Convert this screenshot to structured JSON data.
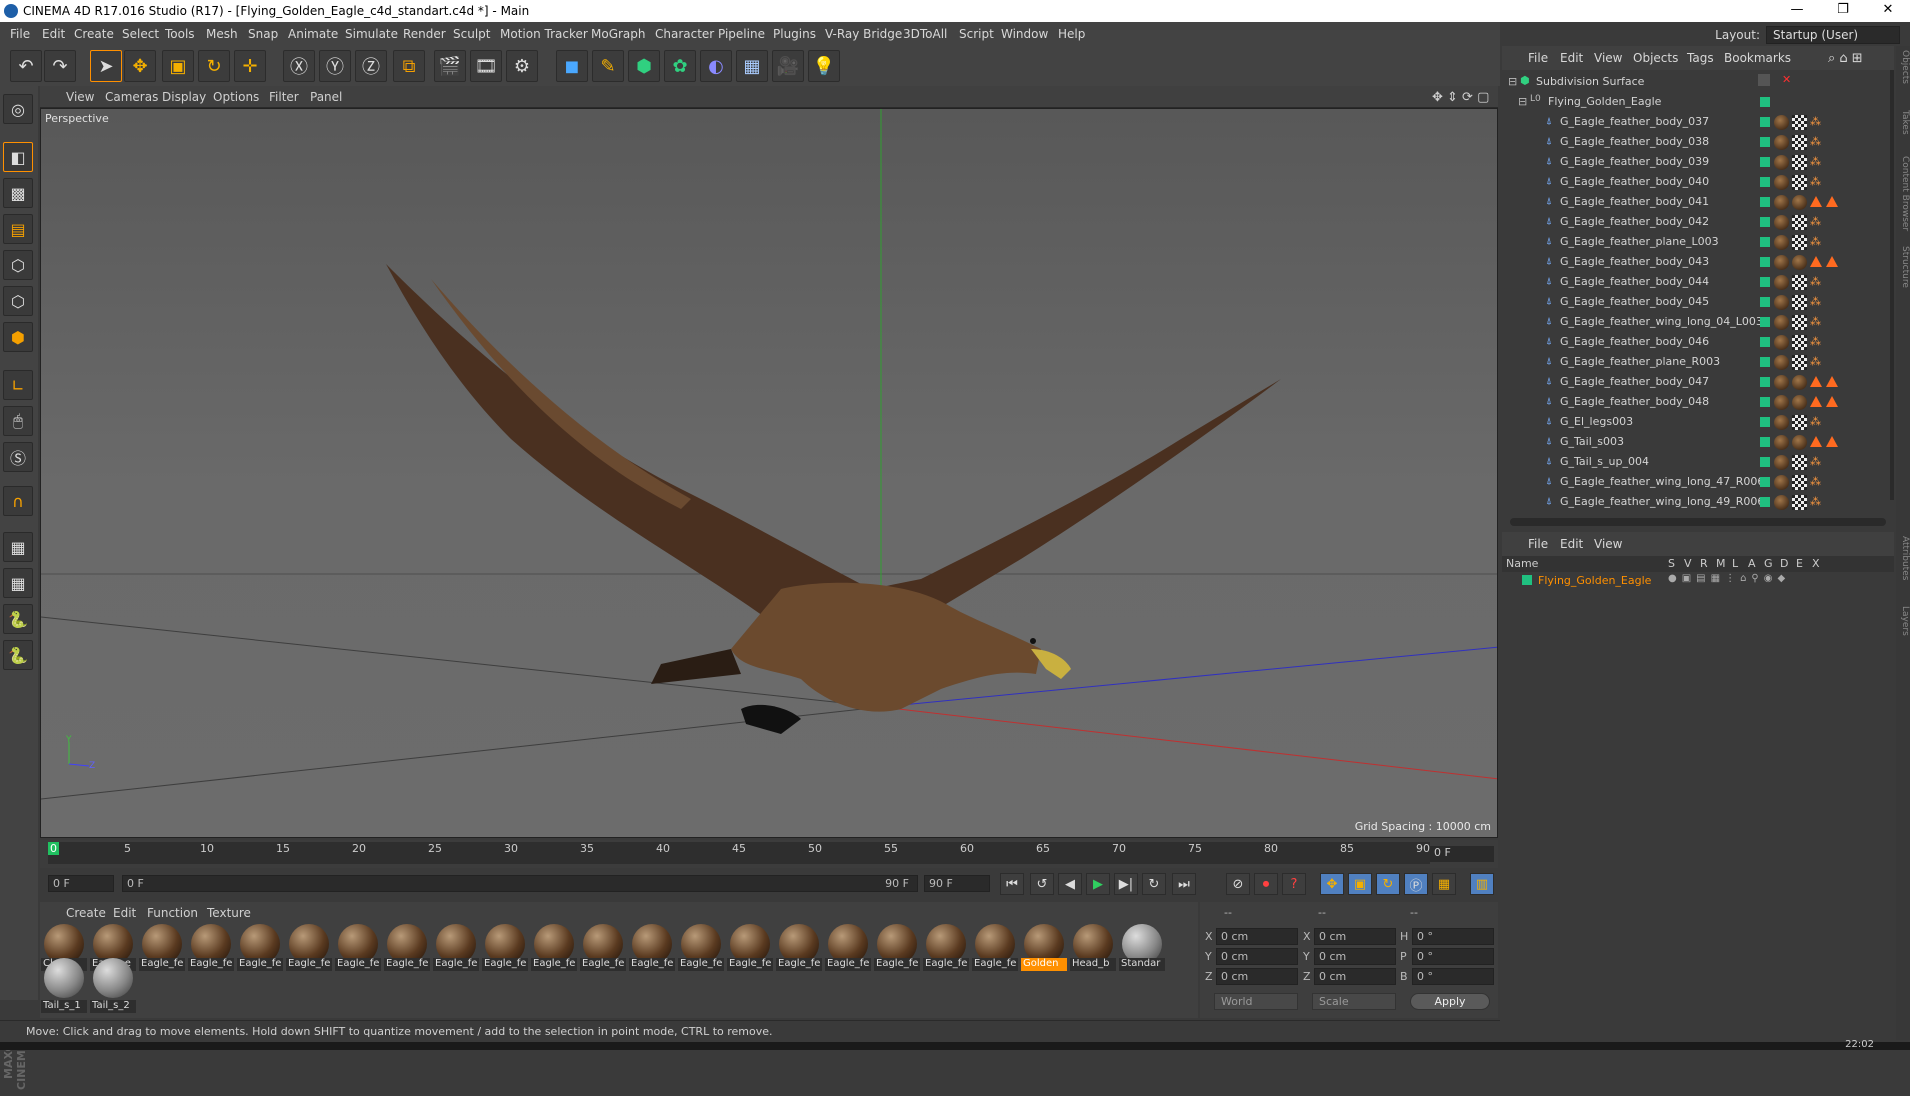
{
  "window": {
    "title": "CINEMA 4D R17.016 Studio (R17) - [Flying_Golden_Eagle_c4d_standart.c4d *] - Main",
    "controls": [
      "—",
      "❐",
      "✕"
    ]
  },
  "menubar": [
    "File",
    "Edit",
    "Create",
    "Select",
    "Tools",
    "Mesh",
    "Snap",
    "Animate",
    "Simulate",
    "Render",
    "Sculpt",
    "Motion Tracker",
    "MoGraph",
    "Character",
    "Pipeline",
    "Plugins",
    "V-Ray Bridge",
    "3DToAll",
    "Script",
    "Window",
    "Help"
  ],
  "layout": {
    "label": "Layout:",
    "value": "Startup (User)"
  },
  "toolbar_icons": [
    "undo-icon",
    "redo-icon",
    "select-pointer-icon",
    "move-icon",
    "scale-icon",
    "rotate-icon",
    "live-select-icon",
    "x-axis-icon",
    "y-axis-icon",
    "z-axis-icon",
    "coordinate-system-icon",
    "render-view-icon",
    "render-picture-viewer-icon",
    "render-settings-icon",
    "cube-icon",
    "pen-spline-icon",
    "subdivision-icon",
    "array-icon",
    "deformer-icon",
    "floor-icon",
    "camera-icon",
    "light-icon"
  ],
  "viewport": {
    "menu": [
      "View",
      "Cameras",
      "Display",
      "Options",
      "Filter",
      "Panel"
    ],
    "label": "Perspective",
    "grid_spacing": "Grid Spacing : 10000 cm"
  },
  "timeline": {
    "ticks": [
      "0",
      "5",
      "10",
      "15",
      "20",
      "25",
      "30",
      "35",
      "40",
      "45",
      "50",
      "55",
      "60",
      "65",
      "70",
      "75",
      "80",
      "85",
      "90"
    ],
    "end_frame": "0 F"
  },
  "playback": {
    "current": "0 F",
    "range_start": "0 F",
    "range_end": "90 F",
    "max": "90 F"
  },
  "materials": {
    "menu": [
      "Create",
      "Edit",
      "Function",
      "Texture"
    ],
    "items": [
      "Claws",
      "Eagle_e",
      "Eagle_fe",
      "Eagle_fe",
      "Eagle_fe",
      "Eagle_fe",
      "Eagle_fe",
      "Eagle_fe",
      "Eagle_fe",
      "Eagle_fe",
      "Eagle_fe",
      "Eagle_fe",
      "Eagle_fe",
      "Eagle_fe",
      "Eagle_fe",
      "Eagle_fe",
      "Eagle_fe",
      "Eagle_fe",
      "Eagle_fe",
      "Eagle_fe",
      "Golden",
      "Head_b",
      "Standar"
    ],
    "selected": "Golden",
    "row2": [
      "Tail_s_1",
      "Tail_s_2"
    ]
  },
  "coords": {
    "headers": [
      "--",
      "--",
      "--"
    ],
    "rows": [
      {
        "a": "X",
        "av": "0 cm",
        "b": "X",
        "bv": "0 cm",
        "c": "H",
        "cv": "0 °"
      },
      {
        "a": "Y",
        "av": "0 cm",
        "b": "Y",
        "bv": "0 cm",
        "c": "P",
        "cv": "0 °"
      },
      {
        "a": "Z",
        "av": "0 cm",
        "b": "Z",
        "bv": "0 cm",
        "c": "B",
        "cv": "0 °"
      }
    ],
    "mode": "World",
    "scale": "Scale",
    "apply": "Apply"
  },
  "status": "Move: Click and drag to move elements. Hold down SHIFT to quantize movement / add to the selection in point mode, CTRL to remove.",
  "clock": "22:02",
  "objects": {
    "menu": [
      "File",
      "Edit",
      "View",
      "Objects",
      "Tags",
      "Bookmarks"
    ],
    "root": "Subdivision Surface",
    "group": "Flying_Golden_Eagle",
    "items": [
      {
        "name": "G_Eagle_feather_body_037",
        "tri": false
      },
      {
        "name": "G_Eagle_feather_body_038",
        "tri": false
      },
      {
        "name": "G_Eagle_feather_body_039",
        "tri": false
      },
      {
        "name": "G_Eagle_feather_body_040",
        "tri": false
      },
      {
        "name": "G_Eagle_feather_body_041",
        "tri": true
      },
      {
        "name": "G_Eagle_feather_body_042",
        "tri": false
      },
      {
        "name": "G_Eagle_feather_plane_L003",
        "tri": false
      },
      {
        "name": "G_Eagle_feather_body_043",
        "tri": true
      },
      {
        "name": "G_Eagle_feather_body_044",
        "tri": false
      },
      {
        "name": "G_Eagle_feather_body_045",
        "tri": false
      },
      {
        "name": "G_Eagle_feather_wing_long_04_L003",
        "tri": false
      },
      {
        "name": "G_Eagle_feather_body_046",
        "tri": false
      },
      {
        "name": "G_Eagle_feather_plane_R003",
        "tri": false
      },
      {
        "name": "G_Eagle_feather_body_047",
        "tri": true
      },
      {
        "name": "G_Eagle_feather_body_048",
        "tri": true
      },
      {
        "name": "G_El_legs003",
        "tri": false
      },
      {
        "name": "G_Tail_s003",
        "tri": true
      },
      {
        "name": "G_Tail_s_up_004",
        "tri": false
      },
      {
        "name": "G_Eagle_feather_wing_long_47_R006",
        "tri": false
      },
      {
        "name": "G_Eagle_feather_wing_long_49_R006",
        "tri": false
      }
    ]
  },
  "attributes": {
    "menu": [
      "File",
      "Edit",
      "View"
    ],
    "columns": [
      "Name",
      "S",
      "V",
      "R",
      "M",
      "L",
      "A",
      "G",
      "D",
      "E",
      "X"
    ],
    "row": "Flying_Golden_Eagle"
  },
  "side_tabs": [
    "Objects",
    "Takes",
    "Content Browser",
    "Structure",
    "Attributes",
    "Layers"
  ],
  "colors": {
    "accent": "#ff9000",
    "object_green": "#20c080",
    "axis_x": "#c03030",
    "axis_y": "#30a030",
    "axis_z": "#3030c0"
  }
}
